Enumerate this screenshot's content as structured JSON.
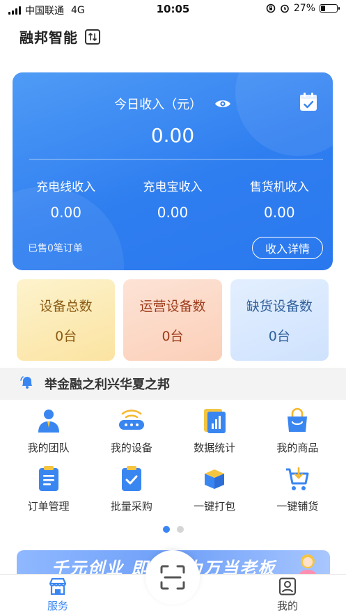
{
  "status_bar": {
    "carrier": "中国联通",
    "network": "4G",
    "time": "10:05",
    "battery": "27%",
    "battery_level": 0.27
  },
  "header": {
    "title": "融邦智能"
  },
  "income_card": {
    "today_label": "今日收入（元）",
    "today_value": "0.00",
    "sub_stats": [
      {
        "label": "充电线收入",
        "value": "0.00"
      },
      {
        "label": "充电宝收入",
        "value": "0.00"
      },
      {
        "label": "售货机收入",
        "value": "0.00"
      }
    ],
    "sold_text": "已售0笔订单",
    "detail_button": "收入详情"
  },
  "device_cards": [
    {
      "label": "设备总数",
      "value": "0台"
    },
    {
      "label": "运营设备数",
      "value": "0台"
    },
    {
      "label": "缺货设备数",
      "value": "0台"
    }
  ],
  "notice": {
    "text": "举金融之利兴华夏之邦"
  },
  "menu": [
    {
      "label": "我的团队",
      "icon": "team-icon"
    },
    {
      "label": "我的设备",
      "icon": "device-icon"
    },
    {
      "label": "数据统计",
      "icon": "statistics-icon"
    },
    {
      "label": "我的商品",
      "icon": "shopping-bag-icon"
    },
    {
      "label": "订单管理",
      "icon": "order-list-icon"
    },
    {
      "label": "批量采购",
      "icon": "clipboard-check-icon"
    },
    {
      "label": "一键打包",
      "icon": "package-icon"
    },
    {
      "label": "一键铺货",
      "icon": "cart-icon"
    }
  ],
  "pager": {
    "pages": 2,
    "active": 1
  },
  "banner": {
    "text": "千元创业 即可成为万当老板"
  },
  "tab_bar": {
    "service_label": "服务",
    "mine_label": "我的"
  },
  "colors": {
    "primary": "#3a86f1",
    "card_blue": "#2f7ef0"
  }
}
